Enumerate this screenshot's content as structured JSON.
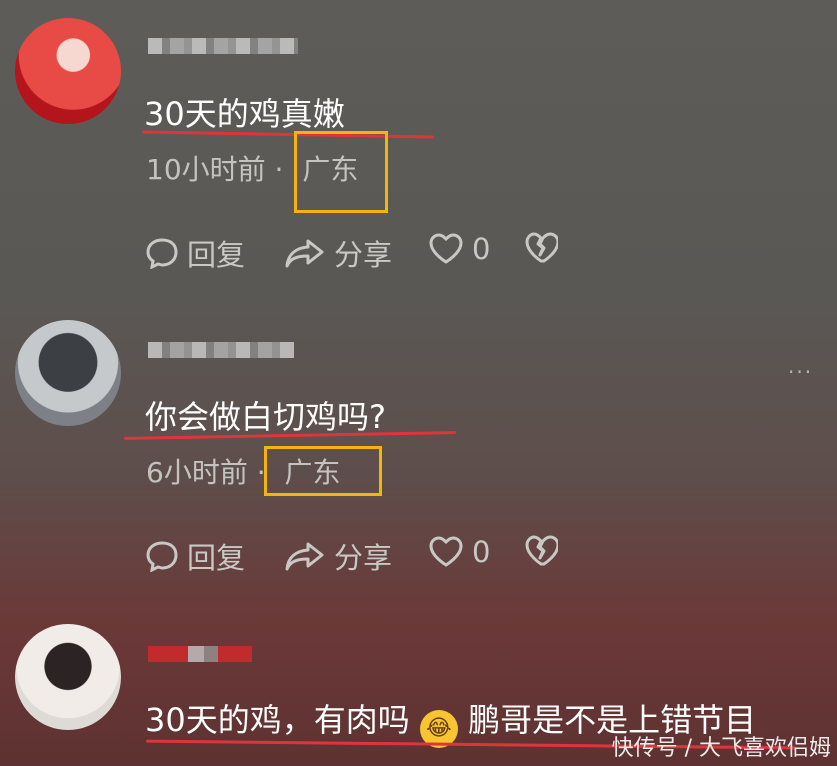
{
  "comments": [
    {
      "text": "30天的鸡真嫩",
      "time": "10小时前",
      "dot": "·",
      "location": "广东",
      "reply_label": "回复",
      "share_label": "分享",
      "like_count": "0"
    },
    {
      "text": "你会做白切鸡吗?",
      "time": "6小时前",
      "dot": "·",
      "location": "广东",
      "reply_label": "回复",
      "share_label": "分享",
      "like_count": "0"
    },
    {
      "text_part1": "30天的鸡，有肉吗",
      "emoji": "😂",
      "text_part2": "鹏哥是不是上错节目"
    }
  ],
  "more_label": "···",
  "watermark": "快传号 / 大飞喜欢侣姆",
  "colors": {
    "highlight": "#f5b40d",
    "underline": "#e0343c"
  }
}
